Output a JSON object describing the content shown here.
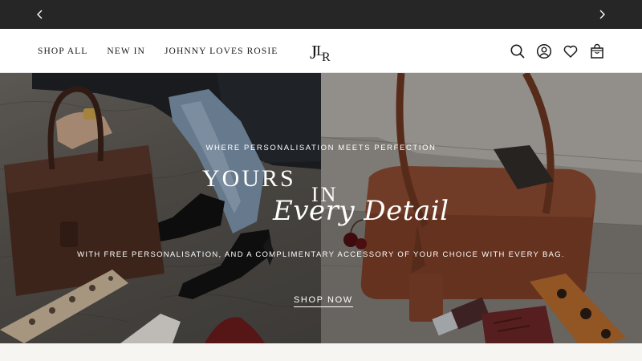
{
  "announcement": {
    "prev_icon": "chevron-left-icon",
    "next_icon": "chevron-right-icon",
    "background": "#262626"
  },
  "nav": {
    "items": [
      "SHOP ALL",
      "NEW IN",
      "JOHNNY LOVES ROSIE"
    ]
  },
  "logo": {
    "text": "JLR"
  },
  "header_icons": [
    "search-icon",
    "account-icon",
    "wishlist-heart-icon",
    "cart-bag-icon"
  ],
  "hero": {
    "tagline": "WHERE PERSONALISATION MEETS PERFECTION",
    "headline_1": "YOURS",
    "headline_2": "IN",
    "headline_script": "Every Detail",
    "subtext": "WITH FREE PERSONALISATION, AND A COMPLIMENTARY ACCESSORY OF YOUR CHOICE WITH EVERY BAG.",
    "cta": "SHOP NOW",
    "colors": {
      "leather": "#7a3e26",
      "dark_leather": "#4a2a1e",
      "text": "#ffffff"
    }
  }
}
